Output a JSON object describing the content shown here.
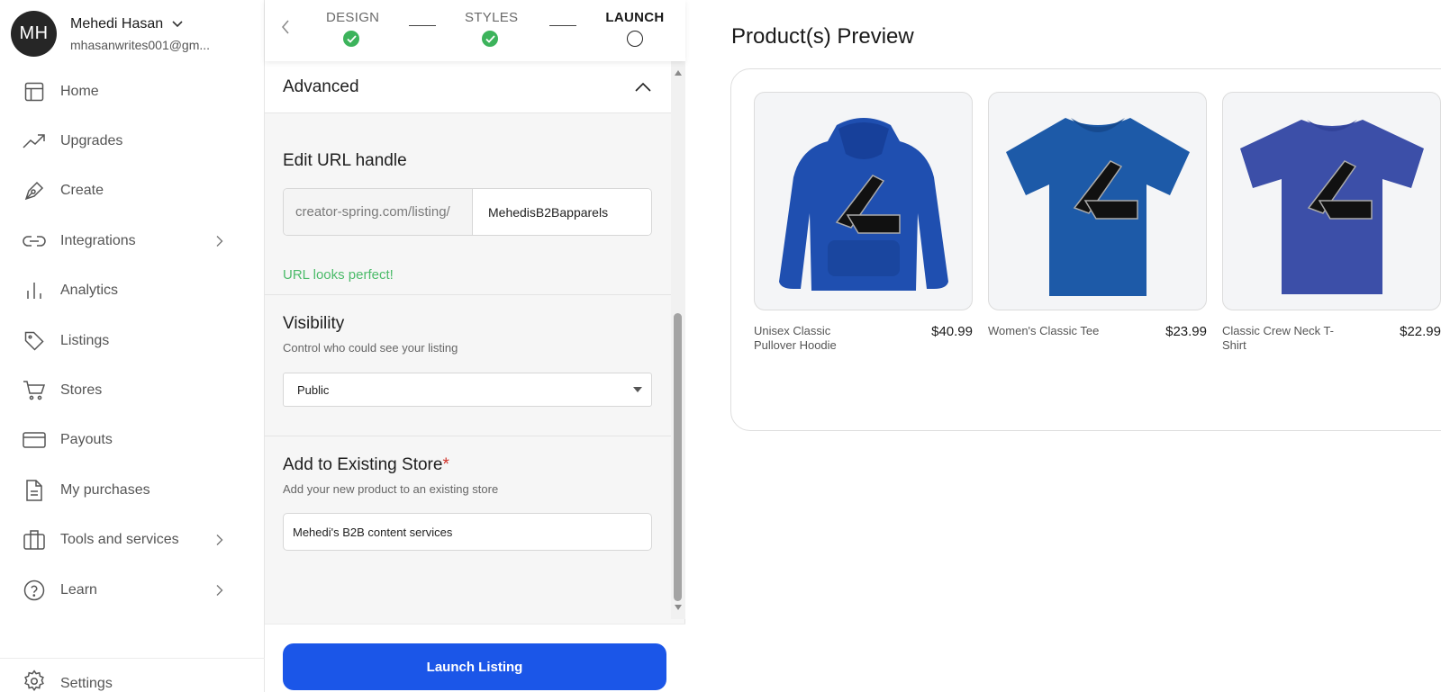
{
  "user": {
    "initials": "MH",
    "name": "Mehedi Hasan",
    "email": "mhasanwrites001@gm..."
  },
  "nav": [
    {
      "label": "Home",
      "icon": "home-icon"
    },
    {
      "label": "Upgrades",
      "icon": "trending-up-icon"
    },
    {
      "label": "Create",
      "icon": "pen-tool-icon"
    },
    {
      "label": "Integrations",
      "icon": "link-icon",
      "chevron": true
    },
    {
      "label": "Analytics",
      "icon": "bar-chart-icon"
    },
    {
      "label": "Listings",
      "icon": "tag-icon"
    },
    {
      "label": "Stores",
      "icon": "cart-icon"
    },
    {
      "label": "Payouts",
      "icon": "credit-card-icon"
    },
    {
      "label": "My purchases",
      "icon": "document-icon"
    },
    {
      "label": "Tools and services",
      "icon": "briefcase-icon",
      "chevron": true
    },
    {
      "label": "Learn",
      "icon": "help-circle-icon",
      "chevron": true
    }
  ],
  "settings_label": "Settings",
  "stepper": {
    "design": "DESIGN",
    "styles": "STYLES",
    "launch": "LAUNCH"
  },
  "advanced": {
    "title": "Advanced"
  },
  "url_handle": {
    "title": "Edit URL handle",
    "prefix": "creator-spring.com/listing/",
    "value": "MehedisB2Bapparels",
    "status": "URL looks perfect!"
  },
  "visibility": {
    "title": "Visibility",
    "subtitle": "Control who could see your listing",
    "selected": "Public"
  },
  "store": {
    "title": "Add to Existing Store",
    "required_mark": "*",
    "subtitle": "Add your new product to an existing store",
    "value": "Mehedi's B2B content services"
  },
  "launch_button": "Launch Listing",
  "preview": {
    "title": "Product(s) Preview",
    "products": [
      {
        "name": "Unisex Classic Pullover Hoodie",
        "price": "$40.99",
        "type": "hoodie",
        "color": "#1f4fb0"
      },
      {
        "name": "Women's Classic Tee",
        "price": "$23.99",
        "type": "tee",
        "color": "#1d5aa8"
      },
      {
        "name": "Classic Crew Neck T-Shirt",
        "price": "$22.99",
        "type": "tee",
        "color": "#3c4fa8"
      }
    ]
  },
  "colors": {
    "accent": "#1b56e8",
    "success": "#3cb35b",
    "required": "#d0342c"
  }
}
